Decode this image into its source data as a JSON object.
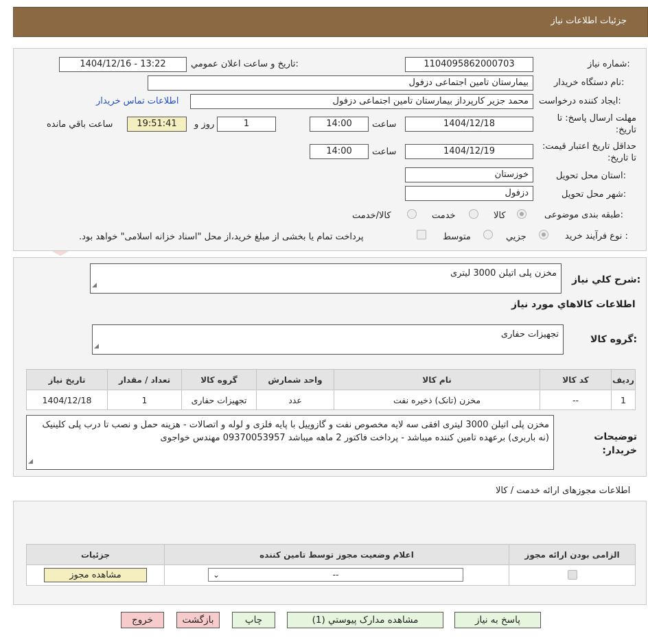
{
  "header": {
    "title": "جزئيات اطلاعات نياز"
  },
  "form": {
    "need_number_label": "شماره نياز:",
    "need_number": "1104095862000703",
    "announce_label": "تاريخ و ساعت اعلان عمومي:",
    "announce_value": "1404/12/16 - 13:22",
    "buyer_org_label": "نام دستگاه خريدار:",
    "buyer_org": "بیمارستان تامین اجتماعی دزفول",
    "creator_label": "ايجاد کننده درخواست:",
    "creator": "محمد جزیر کارپرداز بیمارستان تامین اجتماعی دزفول",
    "contact_link": "اطلاعات تماس خريدار",
    "deadline_label": "مهلت ارسال پاسخ: تا تاريخ:",
    "deadline_date": "1404/12/18",
    "time_label": "ساعت",
    "deadline_time": "14:00",
    "days_value": "1",
    "days_label": "روز و",
    "remaining_time": "19:51:41",
    "remaining_label": "ساعت باقي مانده",
    "validity_label": "حداقل تاريخ اعتبار قيمت: تا تاريخ:",
    "validity_date": "1404/12/19",
    "validity_time": "14:00",
    "province_label": "استان محل تحويل:",
    "province": "خوزستان",
    "city_label": "شهر محل تحويل:",
    "city": "دزفول",
    "category_label": "طبقه بندی موضوعی:",
    "category_options": [
      "کالا",
      "خدمت",
      "کالا/خدمت"
    ],
    "process_label": "نوع فرآيند خريد :",
    "process_options": [
      "جزيي",
      "متوسط"
    ],
    "process_note": "پرداخت تمام يا بخشی از مبلغ خريد،از محل \"اسناد خزانه اسلامی\" خواهد بود."
  },
  "summary": {
    "general_label": "شرح کلي نياز:",
    "general_value": "مخزن پلی اتیلن 3000 لیتری",
    "items_title": "اطلاعات کالاهاي مورد نياز",
    "group_label": "گروه کالا:",
    "group_value": "تجهیزات حفاری"
  },
  "items_table": {
    "headers": [
      "رديف",
      "کد کالا",
      "نام کالا",
      "واحد شمارش",
      "گروه کالا",
      "تعداد / مقدار",
      "تاريخ نياز"
    ],
    "rows": [
      [
        "1",
        "--",
        "مخزن (تانک) ذخیره نفت",
        "عدد",
        "تجهیزات حفاری",
        "1",
        "1404/12/18"
      ]
    ]
  },
  "buyer_notes": {
    "label": "توضيحات خريدار:",
    "text": "مخزن پلی اتیلن 3000 لیتری افقی سه لایه مخصوص نفت و گازوییل با پایه فلزی و لوله و اتصالات - هزینه حمل و نصب تا درب پلی کلینیک (نه باربری) برعهده تامین کننده میباشد - پرداخت فاکتور 2 ماهه میباشد 09370053957 مهندس خواجوی"
  },
  "permits": {
    "title": "اطلاعات مجوزهای ارائه خدمت / کالا",
    "headers": [
      "الزامی بودن ارائه مجوز",
      "اعلام وضعیت مجوز توسط تامین کننده",
      "جزئیات"
    ],
    "select_value": "--",
    "view_button": "مشاهده مجوز"
  },
  "footer": {
    "reply": "پاسخ به نياز",
    "attachments": "مشاهده مدارک پيوستي (1)",
    "print": "چاپ",
    "back": "بازگشت",
    "exit": "خروج"
  },
  "watermark": {
    "text": "AriaTender.net"
  }
}
